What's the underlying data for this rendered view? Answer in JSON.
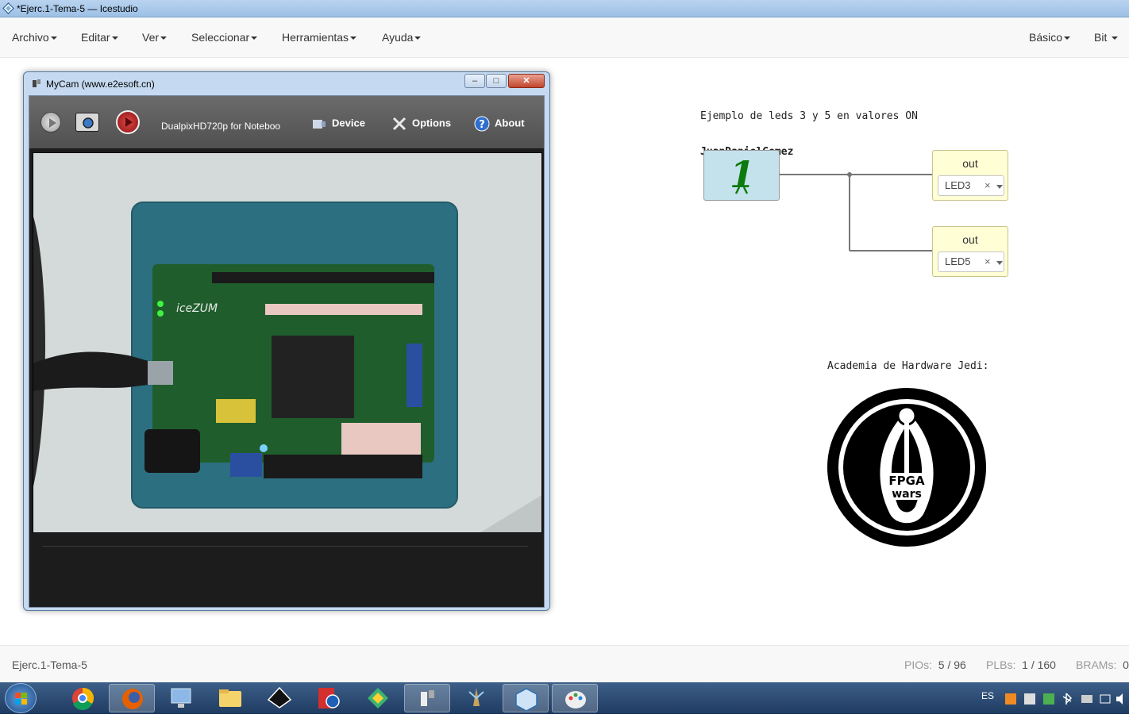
{
  "window": {
    "title": "*Ejerc.1-Tema-5 — Icestudio"
  },
  "menubar": {
    "left": [
      "Archivo",
      "Editar",
      "Ver",
      "Seleccionar",
      "Herramientas",
      "Ayuda"
    ],
    "right": [
      "Básico",
      "Bit"
    ]
  },
  "canvas": {
    "comment_line1": "Ejemplo de leds 3 y 5 en valores ON",
    "comment_line2": "JuanDanielGomez",
    "const_value": "1",
    "out1": {
      "label": "out",
      "pin": "LED3",
      "clear": "×"
    },
    "out2": {
      "label": "out",
      "pin": "LED5",
      "clear": "×"
    },
    "academy_label": "Academia de Hardware Jedi:",
    "logo_text_top": "FPGA",
    "logo_text_bottom": "wars"
  },
  "mycam": {
    "title": "MyCam (www.e2esoft.cn)",
    "device_name": "DualpixHD720p for Noteboo",
    "device_label": "Device",
    "options_label": "Options",
    "about_label": "About",
    "board_label": "iceZUM"
  },
  "statusbar": {
    "filename": "Ejerc.1-Tema-5",
    "pios_label": "PIOs:",
    "pios_value": "5 / 96",
    "plbs_label": "PLBs:",
    "plbs_value": "1 / 160",
    "brams_label": "BRAMs:",
    "brams_value": "0"
  },
  "taskbar": {
    "lang": "ES",
    "items": [
      "chrome-icon",
      "firefox-icon",
      "network-icon",
      "folder-icon",
      "inkscape-icon",
      "settings-app-icon",
      "gitkraken-icon",
      "mycam-icon",
      "icestudio-icon",
      "virtualbox-icon",
      "paint-icon"
    ]
  },
  "colors": {
    "const_block_bg": "#c4e2ec",
    "out_block_bg": "#fffed5",
    "wire": "#777777",
    "const_digit": "#0d7a0d"
  }
}
